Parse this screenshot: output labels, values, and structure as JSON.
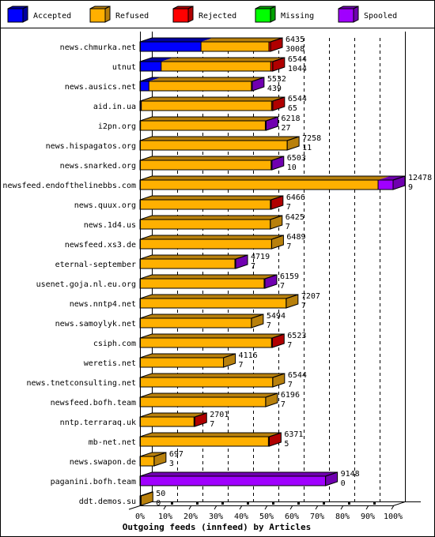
{
  "chart_data": {
    "type": "bar",
    "orientation": "horizontal",
    "stacked": true,
    "three_d": true,
    "title": "",
    "xlabel": "Outgoing feeds (innfeed) by Articles",
    "ylabel": "",
    "xlim": [
      0,
      100
    ],
    "x_unit": "percent of largest total (12478 articles = 100%)",
    "x_ticks": [
      "0%",
      "10%",
      "20%",
      "30%",
      "40%",
      "50%",
      "60%",
      "70%",
      "80%",
      "90%",
      "100%"
    ],
    "grid": true,
    "legend_position": "top",
    "legend": [
      {
        "name": "Accepted",
        "color": "#0000ff",
        "shade": "#0000a0"
      },
      {
        "name": "Refused",
        "color": "#ffb000",
        "shade": "#b8800c"
      },
      {
        "name": "Rejected",
        "color": "#ff0000",
        "shade": "#b00000"
      },
      {
        "name": "Missing",
        "color": "#00ff00",
        "shade": "#00a000"
      },
      {
        "name": "Spooled",
        "color": "#a000ff",
        "shade": "#7000b0"
      }
    ],
    "bar_label_note": "upper number = total offered articles, lower number = accepted articles",
    "categories": [
      "news.chmurka.net",
      "utnut",
      "news.ausics.net",
      "aid.in.ua",
      "i2pn.org",
      "news.hispagatos.org",
      "news.snarked.org",
      "newsfeed.endofthelinebbs.com",
      "news.quux.org",
      "news.1d4.us",
      "newsfeed.xs3.de",
      "eternal-september",
      "usenet.goja.nl.eu.org",
      "news.nntp4.net",
      "news.samoylyk.net",
      "csiph.com",
      "weretis.net",
      "news.tnetconsulting.net",
      "newsfeed.bofh.team",
      "nntp.terraraq.uk",
      "mb-net.net",
      "news.swapon.de",
      "paganini.bofh.team",
      "ddt.demos.su"
    ],
    "totals": [
      6435,
      6544,
      5532,
      6544,
      6218,
      7258,
      6503,
      12478,
      6466,
      6425,
      6489,
      4719,
      6159,
      7207,
      5494,
      6523,
      4116,
      6544,
      6196,
      2701,
      6371,
      697,
      9148,
      50
    ],
    "series": [
      {
        "name": "Accepted",
        "values": [
          3008,
          1044,
          439,
          65,
          27,
          11,
          10,
          9,
          7,
          7,
          7,
          7,
          7,
          7,
          7,
          7,
          7,
          7,
          7,
          7,
          5,
          3,
          0,
          0
        ]
      },
      {
        "name": "Refused",
        "values": [
          3347,
          5400,
          5053,
          6419,
          6151,
          7247,
          6453,
          11729,
          6419,
          6418,
          6482,
          4672,
          6112,
          7200,
          5487,
          6476,
          4109,
          6537,
          6189,
          2654,
          6326,
          694,
          0,
          50
        ]
      },
      {
        "name": "Rejected",
        "values": [
          80,
          100,
          0,
          60,
          0,
          0,
          0,
          0,
          40,
          0,
          0,
          0,
          0,
          0,
          0,
          40,
          0,
          0,
          0,
          40,
          40,
          0,
          0,
          0
        ]
      },
      {
        "name": "Missing",
        "values": [
          0,
          0,
          0,
          0,
          0,
          0,
          0,
          0,
          0,
          0,
          0,
          0,
          0,
          0,
          0,
          0,
          0,
          0,
          0,
          0,
          0,
          0,
          0,
          0
        ]
      },
      {
        "name": "Spooled",
        "values": [
          0,
          0,
          40,
          0,
          40,
          0,
          40,
          740,
          0,
          0,
          0,
          40,
          40,
          0,
          0,
          0,
          0,
          0,
          0,
          0,
          0,
          0,
          9148,
          0
        ]
      }
    ]
  }
}
